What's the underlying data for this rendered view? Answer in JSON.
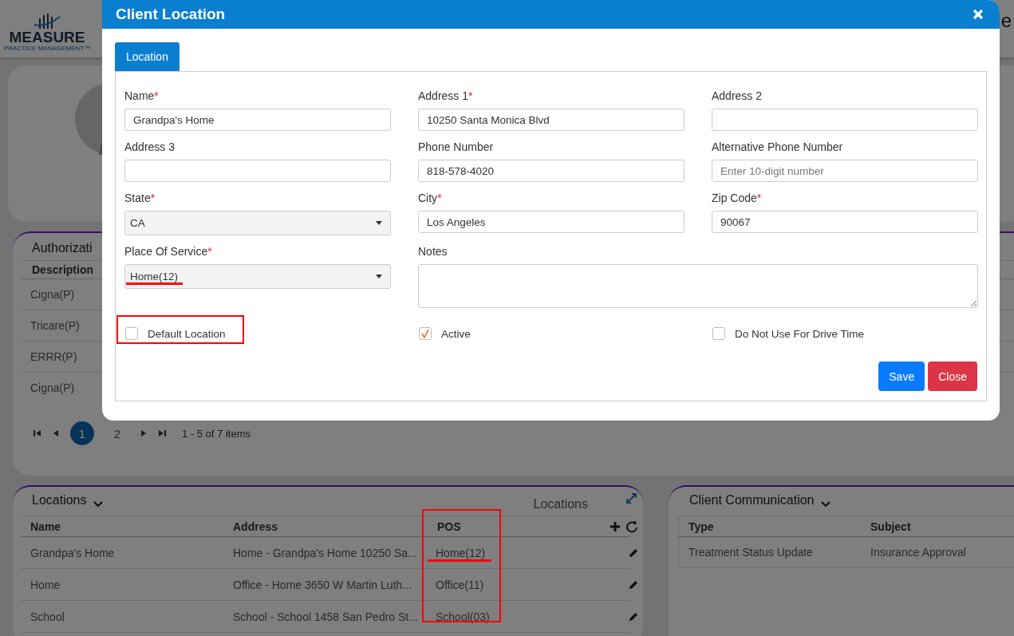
{
  "header": {
    "logo_text": "MEASURE",
    "logo_subtext": "PRACTICE MANAGEMENT™",
    "title_end": "e"
  },
  "authorizations": {
    "title": "Authorizati",
    "columns": [
      "Description"
    ],
    "rows": [
      "Cigna(P)",
      "Tricare(P)",
      "ERRR(P)",
      "Cigna(P)"
    ],
    "pagination": {
      "pages": [
        {
          "label": "1",
          "selected": true
        },
        {
          "label": "2",
          "selected": false
        }
      ],
      "summary": "1 - 5 of 7 items"
    }
  },
  "locations": {
    "title": "Locations",
    "caption": "Locations",
    "columns": [
      "Name",
      "Address",
      "POS"
    ],
    "rows": [
      {
        "name": "Grandpa's Home",
        "address": "Home - Grandpa's Home 10250 Sa...",
        "pos": "Home(12)"
      },
      {
        "name": "Home",
        "address": "Office - Home 3650 W Martin Luth...",
        "pos": "Office(11)"
      },
      {
        "name": "School",
        "address": "School - School 1458 San Pedro St...",
        "pos": "School(03)"
      }
    ]
  },
  "client_communication": {
    "title": "Client Communication",
    "columns": [
      "Type",
      "Subject"
    ],
    "rows": [
      {
        "type": "Treatment Status Update",
        "subject": "Insurance Approval"
      }
    ]
  },
  "modal": {
    "title": "Client Location",
    "tabs": [
      {
        "label": "Location",
        "selected": true
      }
    ],
    "fields": [
      {
        "label": "Name",
        "required_mark": "*",
        "kind": "text",
        "value": "Grandpa's Home"
      },
      {
        "label": "Address 1",
        "required_mark": "*",
        "kind": "text",
        "value": "10250 Santa Monica Blvd"
      },
      {
        "label": "Address 2",
        "kind": "text"
      },
      {
        "label": "Address 3",
        "kind": "text"
      },
      {
        "label": "Phone Number",
        "kind": "text",
        "value": "818-578-4020"
      },
      {
        "label": "Alternative Phone Number",
        "kind": "text",
        "placeholder": "Enter 10-digit number"
      },
      {
        "label": "State",
        "required_mark": "*",
        "kind": "select",
        "value": "CA"
      },
      {
        "label": "City",
        "required_mark": "*",
        "kind": "text",
        "value": "Los Angeles"
      },
      {
        "label": "Zip Code",
        "required_mark": "*",
        "kind": "text",
        "value": "90067"
      },
      {
        "label": "Place Of Service",
        "required_mark": "*",
        "kind": "select",
        "value": "Home(12)"
      },
      {
        "label": "Notes",
        "kind": "textarea"
      }
    ],
    "checkboxes": [
      {
        "label": "Default Location",
        "checked": false
      },
      {
        "label": "Active",
        "checked": true
      },
      {
        "label": "Do Not Use For Drive Time",
        "checked": false
      }
    ],
    "buttons": [
      {
        "label": "Save",
        "kind": "primary"
      },
      {
        "label": "Close",
        "kind": "danger"
      }
    ]
  }
}
